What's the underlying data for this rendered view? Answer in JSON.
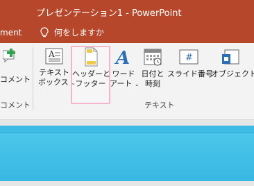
{
  "titlebar": {
    "title": "プレゼンテーション1  -  PowerPoint"
  },
  "tellbar": {
    "tab_fragment": "ment",
    "tell_me": "何をしますか"
  },
  "ribbon": {
    "buttons": {
      "comment": "コメント",
      "textbox_line1": "テキスト",
      "textbox_line2": "ボックス",
      "header_line1": "ヘッダーと",
      "header_line2": "フッター",
      "wordart_line1": "ワード",
      "wordart_line2": "アート",
      "datetime_line1": "日付と",
      "datetime_line2": "時刻",
      "slide_number": "スライド番号",
      "object": "オブジェクト"
    },
    "groups": {
      "comment_group": "コメント",
      "text_group": "テキスト"
    }
  },
  "colors": {
    "accent": "#b7472a",
    "ribbon_bg": "#f3f3f3",
    "slide_blue": "#41c2ea",
    "highlight": "#f4b4cc"
  }
}
